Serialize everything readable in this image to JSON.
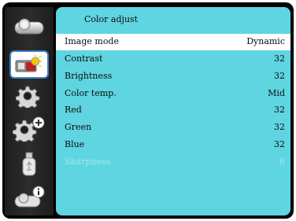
{
  "sidebar": {
    "items": [
      {
        "icon": "projector-icon"
      },
      {
        "icon": "picture-adjust-icon",
        "active": true
      },
      {
        "icon": "gear-icon"
      },
      {
        "icon": "advanced-gear-icon"
      },
      {
        "icon": "usb-icon"
      },
      {
        "icon": "info-projector-icon"
      }
    ]
  },
  "menu": {
    "title": "Color adjust",
    "items": [
      {
        "label": "Image mode",
        "value": "Dynamic"
      },
      {
        "label": "Contrast",
        "value": "32"
      },
      {
        "label": "Brightness",
        "value": "32"
      },
      {
        "label": "Color temp.",
        "value": "Mid"
      },
      {
        "label": "Red",
        "value": "32"
      },
      {
        "label": "Green",
        "value": "32"
      },
      {
        "label": "Blue",
        "value": "32"
      },
      {
        "label": "Sharpness",
        "value": "8"
      }
    ]
  },
  "colors": {
    "panel_bg": "#5fd5e1",
    "selected_row_bg": "#ffffff",
    "disabled_text": "#9fe6ee",
    "frame": "#000000"
  }
}
